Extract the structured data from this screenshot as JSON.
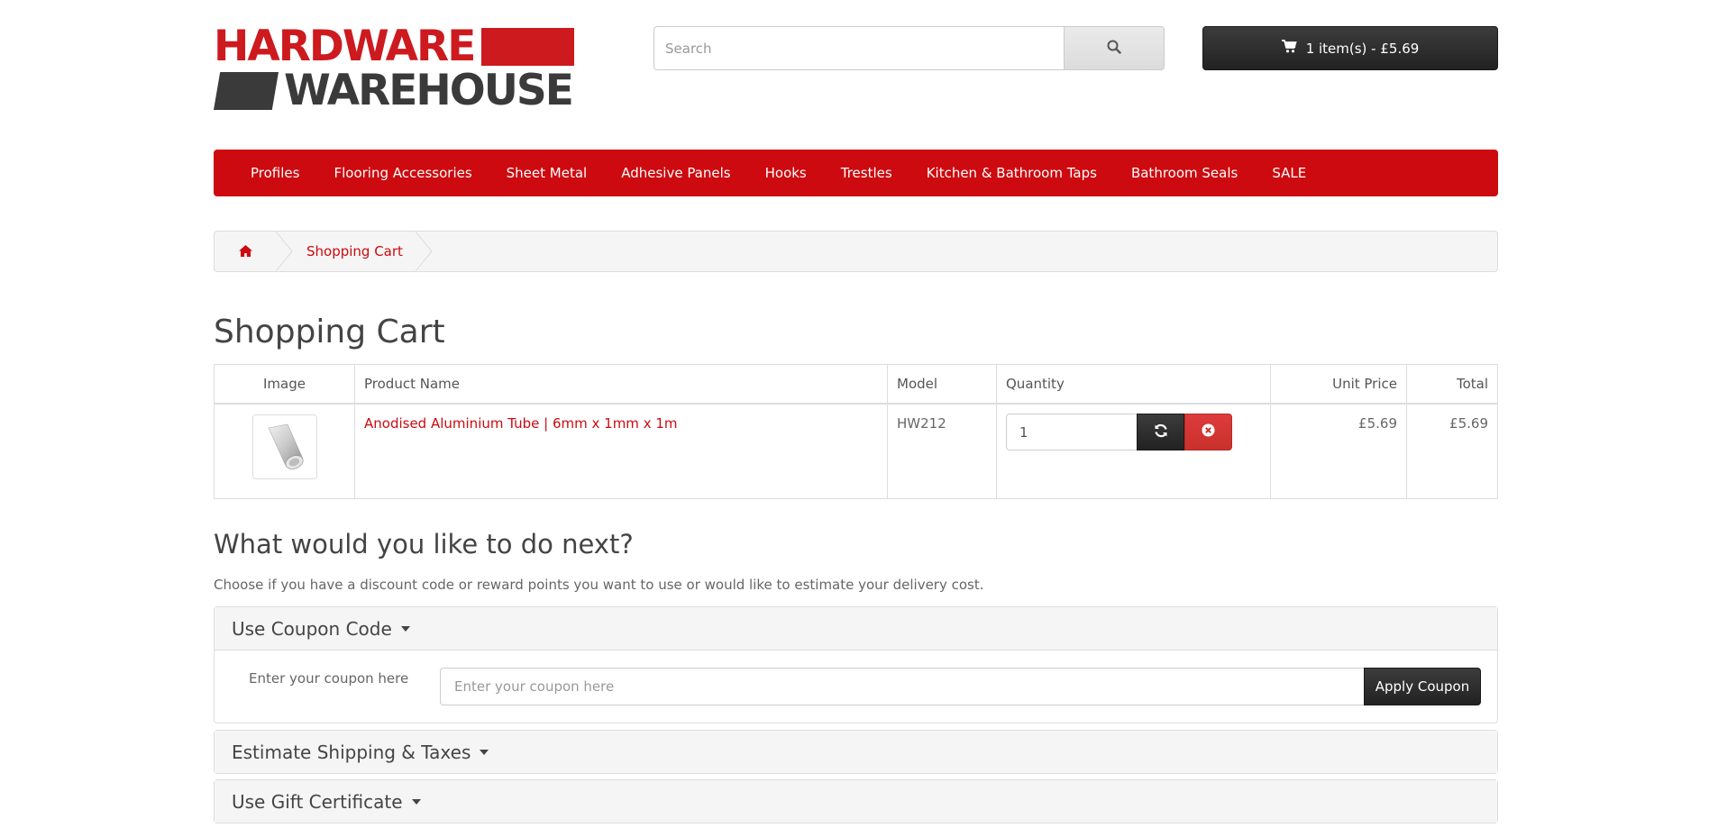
{
  "logo": {
    "line1": "HARDWARE",
    "line2": "WAREHOUSE"
  },
  "search": {
    "placeholder": "Search",
    "icon": "search-icon"
  },
  "cart_button": {
    "label": "1 item(s) - £5.69",
    "icon": "cart-icon"
  },
  "menu": {
    "items": [
      {
        "label": "Profiles"
      },
      {
        "label": "Flooring Accessories"
      },
      {
        "label": "Sheet Metal"
      },
      {
        "label": "Adhesive Panels"
      },
      {
        "label": "Hooks"
      },
      {
        "label": "Trestles"
      },
      {
        "label": "Kitchen & Bathroom Taps"
      },
      {
        "label": "Bathroom Seals"
      },
      {
        "label": "SALE"
      }
    ]
  },
  "breadcrumb": {
    "home_icon": "home-icon",
    "current": "Shopping Cart"
  },
  "page_title": "Shopping Cart",
  "cart_table": {
    "headers": [
      "Image",
      "Product Name",
      "Model",
      "Quantity",
      "Unit Price",
      "Total"
    ],
    "rows": [
      {
        "product_name": "Anodised Aluminium Tube | 6mm x 1mm x 1m",
        "model": "HW212",
        "quantity": "1",
        "unit_price": "£5.69",
        "total": "£5.69"
      }
    ]
  },
  "next": {
    "title": "What would you like to do next?",
    "description": "Choose if you have a discount code or reward points you want to use or would like to estimate your delivery cost."
  },
  "coupon": {
    "heading": "Use Coupon Code",
    "label": "Enter your coupon here",
    "placeholder": "Enter your coupon here",
    "button": "Apply Coupon"
  },
  "shipping": {
    "heading": "Estimate Shipping & Taxes"
  },
  "gift": {
    "heading": "Use Gift Certificate"
  },
  "colors": {
    "brand_red": "#cc0a0f",
    "dark": "#222222"
  }
}
